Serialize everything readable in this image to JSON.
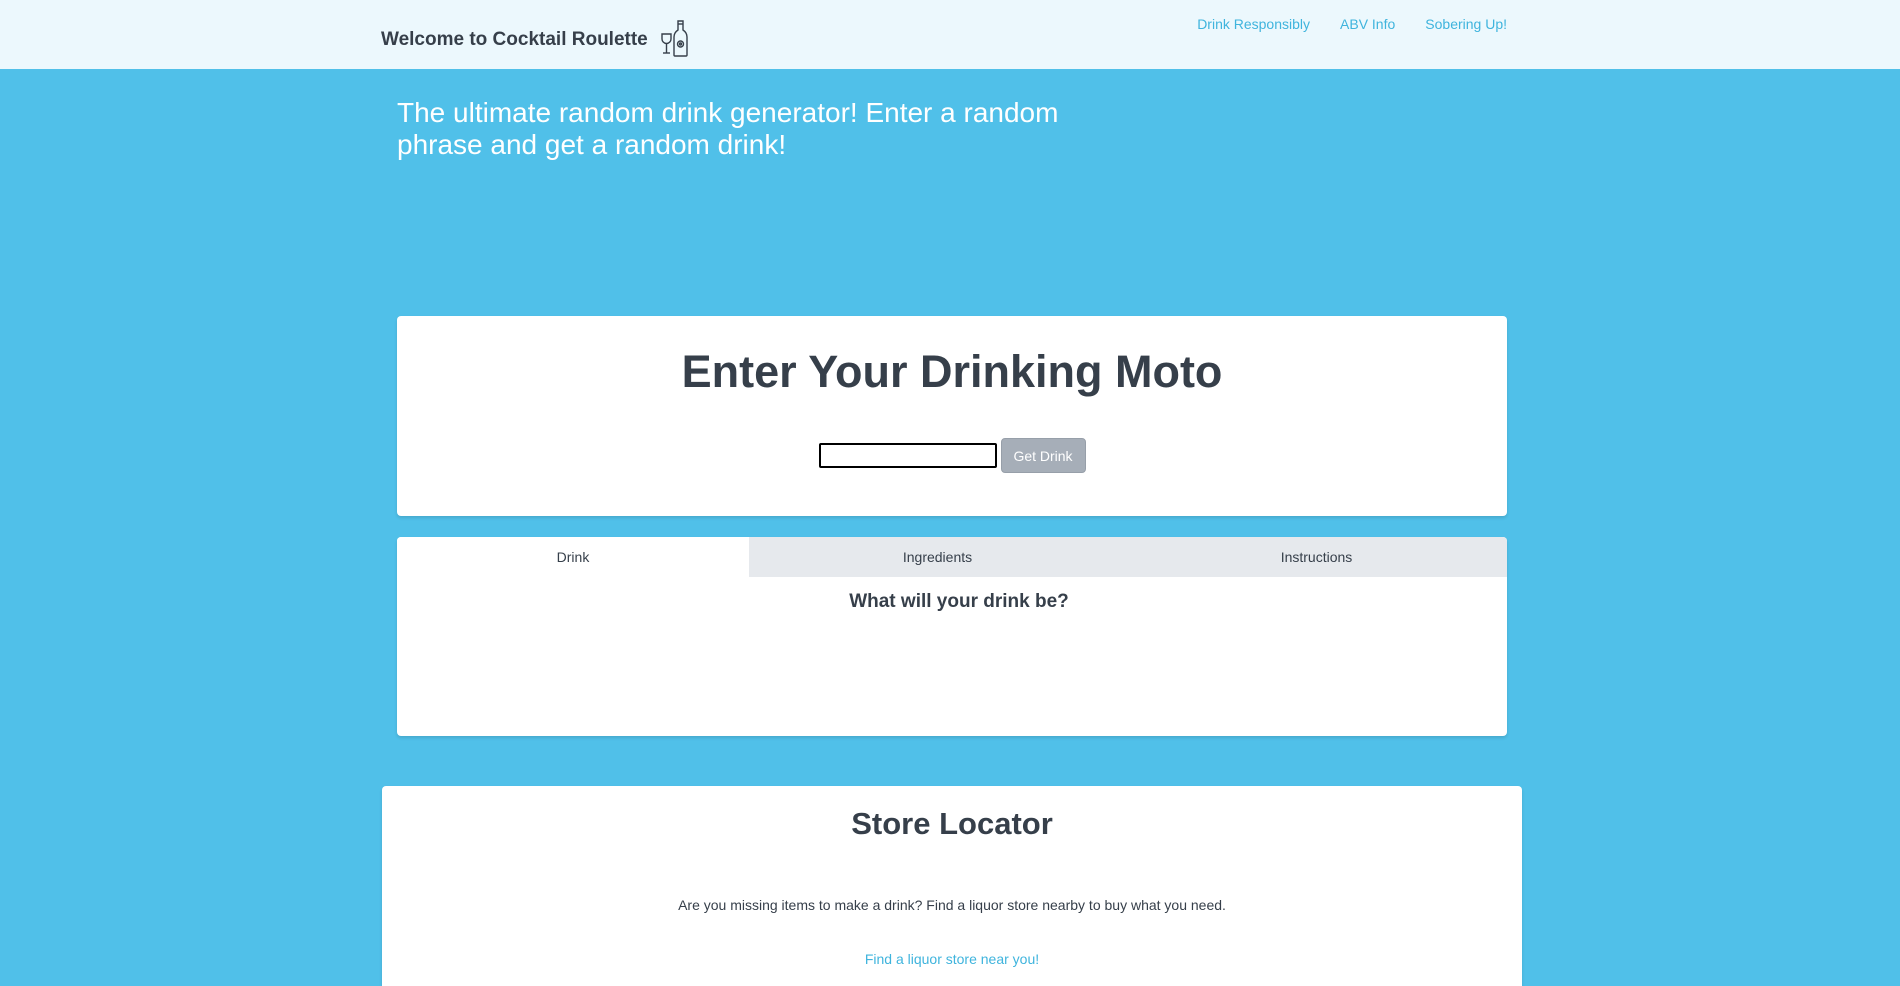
{
  "navbar": {
    "brand": "Welcome to Cocktail Roulette",
    "brand_icon": "wine-bottle-glass-icon",
    "links": [
      "Drink Responsibly",
      "ABV Info",
      "Sobering Up!"
    ]
  },
  "hero": {
    "text": "The ultimate random drink generator! Enter a random phrase and get a random drink!"
  },
  "moto": {
    "title": "Enter Your Drinking Moto",
    "input_value": "",
    "button_label": "Get Drink"
  },
  "tabs": {
    "items": [
      "Drink",
      "Ingredients",
      "Instructions"
    ],
    "active": "Drink",
    "heading": "What will your drink be?"
  },
  "store": {
    "title": "Store Locator",
    "description": "Are you missing items to make a drink? Find a liquor store nearby to buy what you need.",
    "link": "Find a liquor store near you!"
  },
  "colors": {
    "background": "#50c0e9",
    "navbar": "#ecf8fd",
    "link": "#3fb4dd",
    "text": "#363f4a",
    "button": "#a6aeb8"
  }
}
